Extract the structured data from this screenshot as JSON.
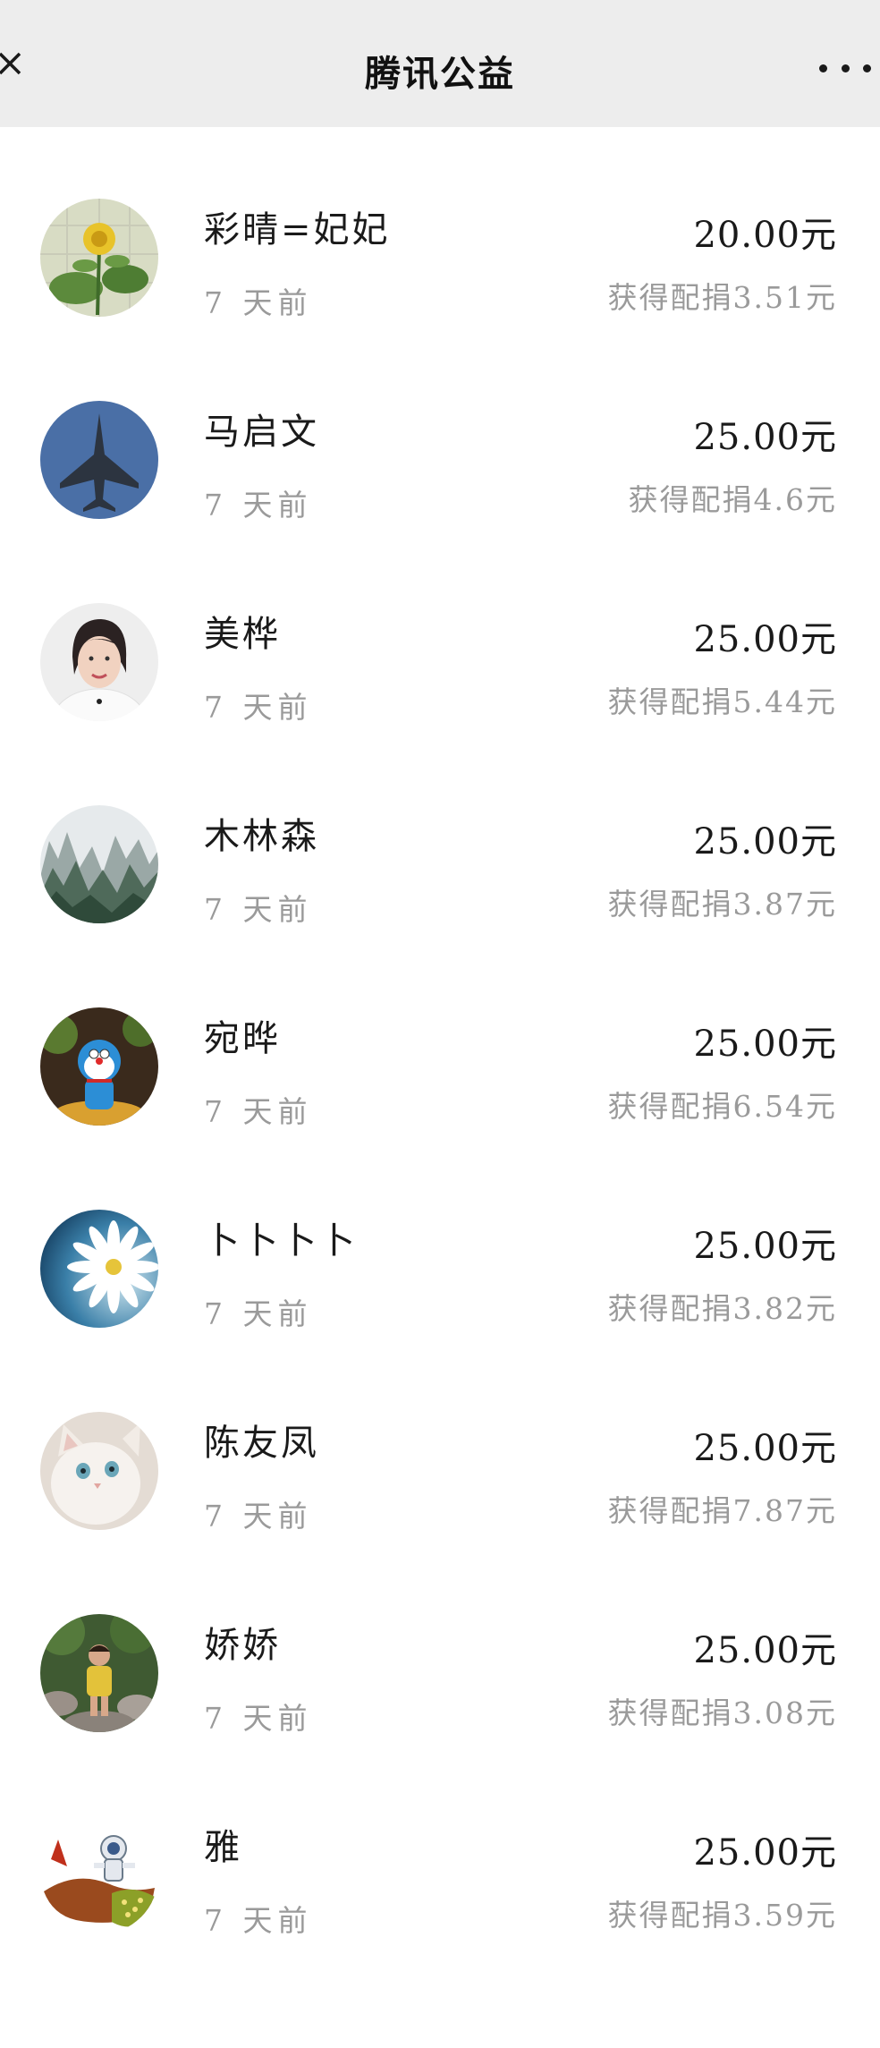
{
  "header": {
    "title": "腾讯公益",
    "close_icon": "close-icon",
    "more_icon": "more-dots-icon"
  },
  "donations": [
    {
      "name": "彩晴=妃妃",
      "time": "7 天前",
      "amount": "20.00元",
      "match": "获得配捐3.51元",
      "avatar": "yellow-flower-avatar"
    },
    {
      "name": "马启文",
      "time": "7 天前",
      "amount": "25.00元",
      "match": "获得配捐4.6元",
      "avatar": "fighter-jet-avatar"
    },
    {
      "name": "美桦",
      "time": "7 天前",
      "amount": "25.00元",
      "match": "获得配捐5.44元",
      "avatar": "woman-portrait-avatar"
    },
    {
      "name": "木林森",
      "time": "7 天前",
      "amount": "25.00元",
      "match": "获得配捐3.87元",
      "avatar": "misty-mountain-avatar"
    },
    {
      "name": "宛晔",
      "time": "7 天前",
      "amount": "25.00元",
      "match": "获得配捐6.54元",
      "avatar": "doraemon-avatar"
    },
    {
      "name": "卜卜卜卜",
      "time": "7 天前",
      "amount": "25.00元",
      "match": "获得配捐3.82元",
      "avatar": "daisy-avatar"
    },
    {
      "name": "陈友凤",
      "time": "7 天前",
      "amount": "25.00元",
      "match": "获得配捐7.87元",
      "avatar": "white-cat-avatar"
    },
    {
      "name": "娇娇",
      "time": "7 天前",
      "amount": "25.00元",
      "match": "获得配捐3.08元",
      "avatar": "child-rocks-avatar"
    },
    {
      "name": "雅",
      "time": "7 天前",
      "amount": "25.00元",
      "match": "获得配捐3.59元",
      "avatar": "astronaut-cartoon-avatar"
    }
  ]
}
